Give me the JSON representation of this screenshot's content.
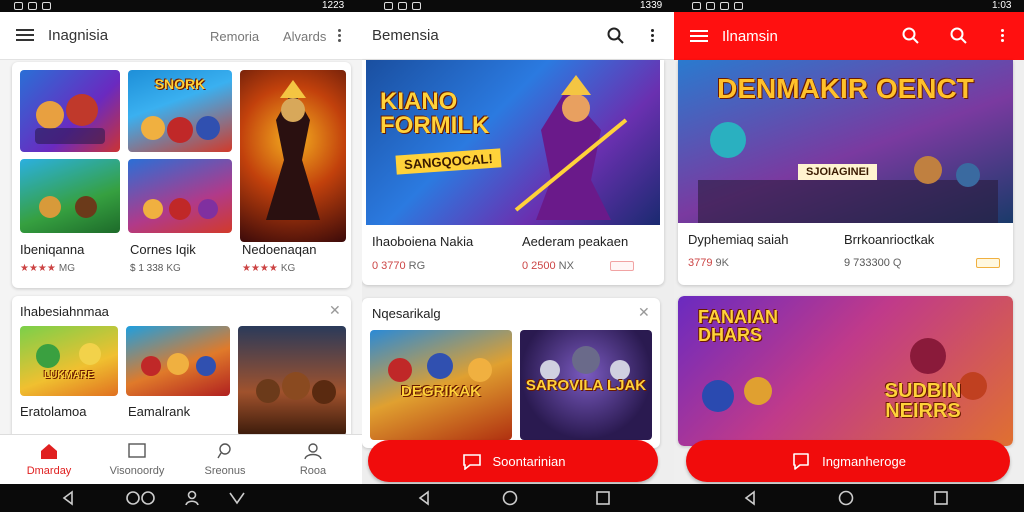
{
  "status": {
    "times": [
      "1223",
      "1339",
      "1:03"
    ]
  },
  "screen1": {
    "title": "Inagnisia",
    "tabs": [
      "Remoria",
      "Alvards"
    ],
    "cards_top": [
      {
        "thumb_title": "",
        "label": "Ibeniqanna",
        "rating": "★★★★",
        "meta": "MG"
      },
      {
        "thumb_title": "SNORK",
        "label": "Cornes Iqik",
        "rating": "$ 1 338",
        "meta": "KG"
      },
      {
        "thumb_title": "",
        "label": "Nedoenaqan",
        "rating": "★★★★",
        "meta": "KG"
      }
    ],
    "section_title": "Ihabesiahnmaa",
    "section_items": [
      {
        "thumb_title": "LUKMARE",
        "label": "Eratolamoa"
      },
      {
        "thumb_title": "",
        "label": "Eamalrank"
      },
      {
        "thumb_title": "",
        "label": ""
      }
    ],
    "bottom_nav": [
      "Dmarday",
      "Visonoordy",
      "Sreonus",
      "Rooa"
    ]
  },
  "screen2": {
    "title": "Bemensia",
    "hero_title": "KIANO FORMILK",
    "hero_sub": "SANGQOCAL!",
    "items": [
      {
        "label": "Ihaoboiena Nakia",
        "price": "0 3770",
        "meta": "RG"
      },
      {
        "label": "Aederam peakaen",
        "price": "0 2500",
        "meta": "NX"
      }
    ],
    "section_title": "Nqesarikalg",
    "section_items": [
      {
        "thumb_title": "DEGRIKAK"
      },
      {
        "thumb_title": "SAROVILA LJAK"
      }
    ],
    "cta_label": "Soontarinian"
  },
  "screen3": {
    "title": "Ilnamsin",
    "hero_title": "DENMAKIR OENCT",
    "hero_sub": "SJOIAGINEI",
    "items": [
      {
        "label": "Dyphemiaq saiah",
        "price": "3779",
        "meta": "9K"
      },
      {
        "label": "Brrkoanrioctkak",
        "price": "9 733300",
        "meta": "Q"
      }
    ],
    "promo_title": "FANAIAN DHARS",
    "promo_sub": "SUDBIN NEIRRS",
    "cta_label": "Ingmanheroge"
  },
  "colors": {
    "accent": "#ff1010",
    "cta": "#f10c0c",
    "star": "#e05a2a"
  },
  "icons": [
    "menu-icon",
    "search-icon",
    "kebab-icon",
    "home-icon",
    "chat-icon",
    "user-icon",
    "back-icon",
    "home-circle-icon",
    "recents-icon",
    "close-icon"
  ]
}
